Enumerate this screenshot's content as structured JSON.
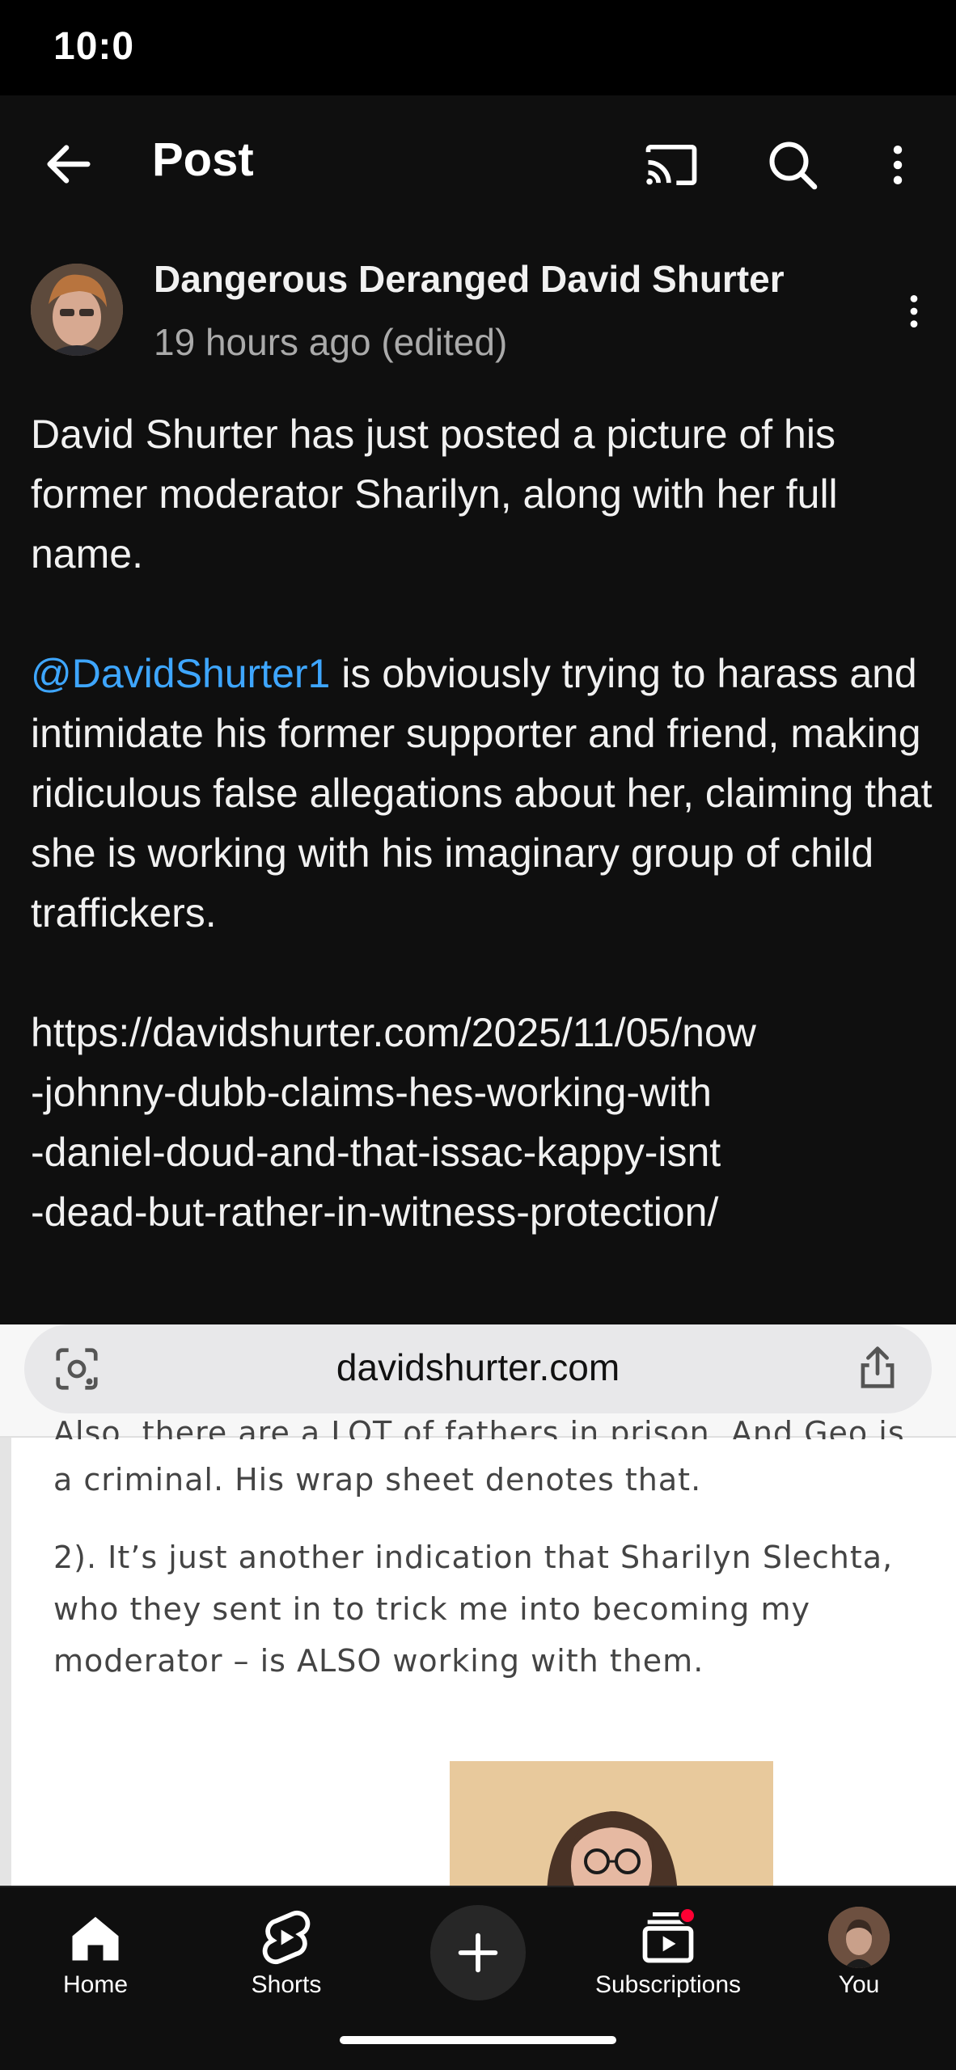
{
  "status_bar": {
    "time": "10:0"
  },
  "app_bar": {
    "title": "Post",
    "icons": [
      "back-arrow-icon",
      "cast-icon",
      "search-icon",
      "more-vert-icon"
    ]
  },
  "post": {
    "channel_name": "Dangerous Deranged David Shurter",
    "timestamp": "19 hours ago (edited)",
    "paragraph_1": "David Shurter has just posted a picture of his former moderator Sharilyn, along with her full name.",
    "mention": "@DavidShurter1",
    "paragraph_2_rest": " is obviously trying to harass and intimidate his former supporter and friend, making ridiculous false allegations about her, claiming that she is working with his imaginary group of child traffickers.",
    "url_lines": [
      "https://davidshurter.com/2025/11/05/now",
      "-johnny-dubb-claims-hes-working-with",
      "-daniel-doud-and-that-issac-kappy-isnt",
      "-dead-but-rather-in-witness-protection/"
    ]
  },
  "embed": {
    "browser_url": "davidshurter.com",
    "cut_line": "Also, there are a LOT of fathers in prison. And Geo is",
    "line_1": "a criminal. His wrap sheet denotes that.",
    "line_2": "2). It’s just another indication that Sharilyn Slechta, who they sent in to trick me into becoming my moderator – is ALSO working with them."
  },
  "bottom_nav": {
    "home": "Home",
    "shorts": "Shorts",
    "subscriptions": "Subscriptions",
    "you": "You"
  },
  "colors": {
    "background": "#0f0f0f",
    "mention": "#3ea6ff",
    "secondary_text": "#aaaaaa",
    "notification_dot": "#ff0033"
  }
}
